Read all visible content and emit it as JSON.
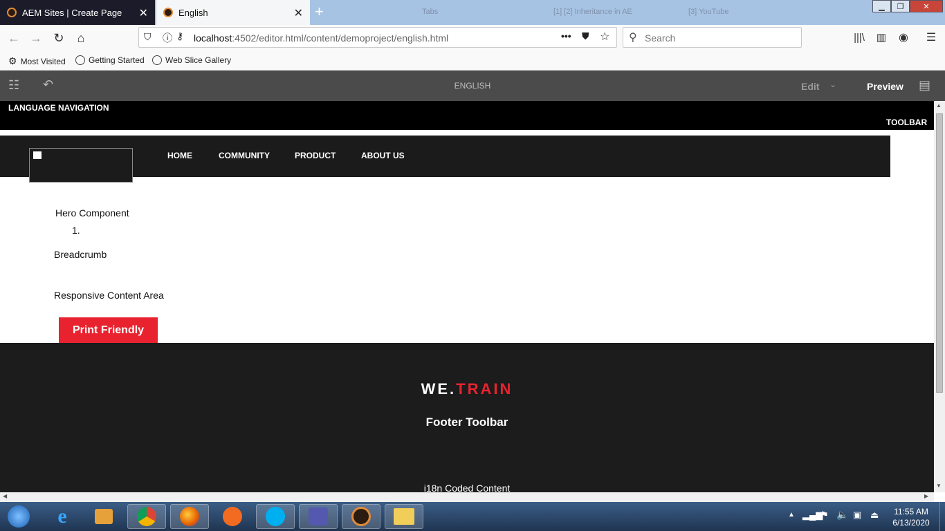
{
  "browser": {
    "tabs": [
      {
        "title": "AEM Sites | Create Page",
        "active": false
      },
      {
        "title": "English",
        "active": true
      }
    ],
    "background_tabs": [
      "Tabs",
      "[1] [2] Inheritance in AE",
      "[3] YouTube"
    ],
    "url_host": "localhost",
    "url_rest": ":4502/editor.html/content/demoproject/english.html",
    "search_placeholder": "Search",
    "bookmarks": [
      "Most Visited",
      "Getting Started",
      "Web Slice Gallery"
    ]
  },
  "aem_toolbar": {
    "page_title": "ENGLISH",
    "mode_label": "Edit",
    "preview_label": "Preview"
  },
  "page": {
    "language_navigation": "LANGUAGE NAVIGATION",
    "toolbar": "TOOLBAR",
    "nav": [
      "HOME",
      "COMMUNITY",
      "PRODUCT",
      "ABOUT US"
    ],
    "hero": "Hero Component",
    "list_marker": "1.",
    "breadcrumb": "Breadcrumb",
    "responsive_area": "Responsive Content Area",
    "print_button": "Print Friendly",
    "footer": {
      "brand_we": "WE.",
      "brand_train": "TRAIN",
      "toolbar": "Footer Toolbar",
      "i18n": "i18n Coded Content"
    }
  },
  "taskbar": {
    "time": "11:55 AM",
    "date": "6/13/2020"
  },
  "colors": {
    "accent_red": "#e8232f",
    "aem_bar": "#4b4b4b",
    "header_dark": "#1b1b1b",
    "footer_dark": "#1c1c1c"
  }
}
